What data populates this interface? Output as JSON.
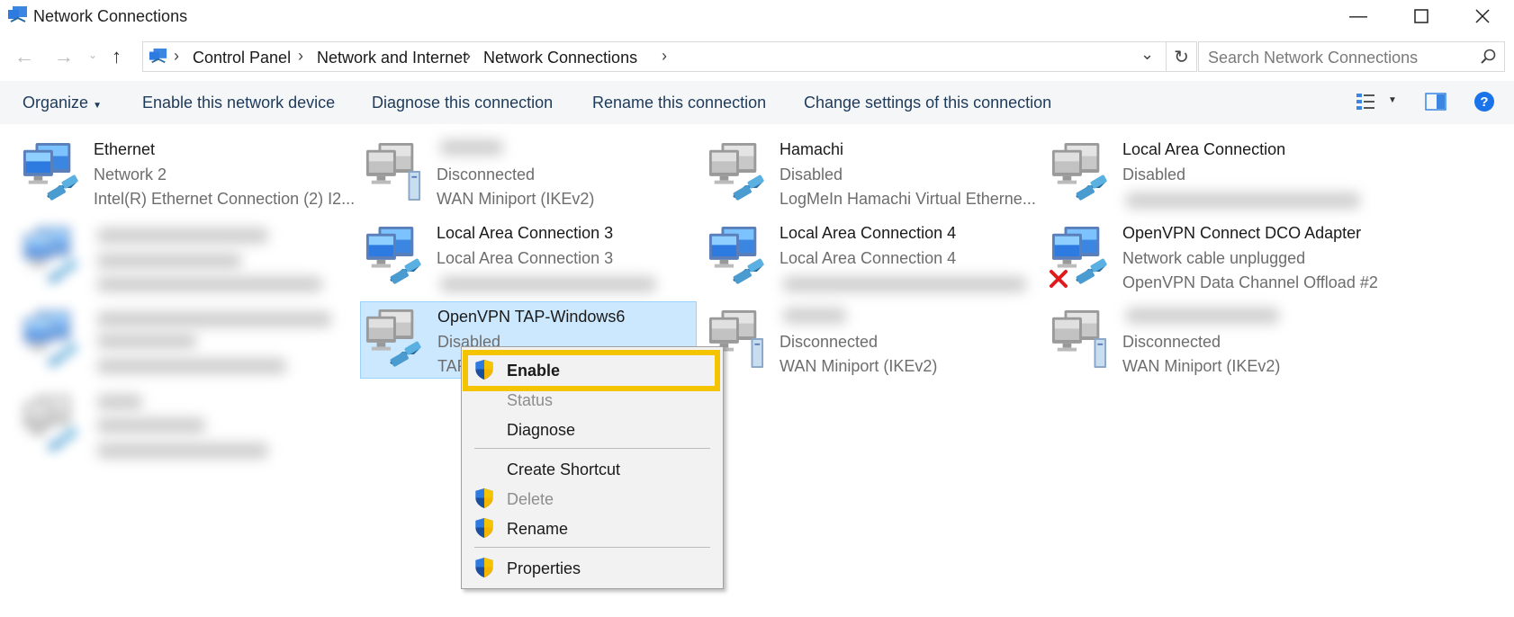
{
  "window": {
    "title": "Network Connections"
  },
  "address": {
    "crumbs": [
      "Control Panel",
      "Network and Internet",
      "Network Connections"
    ],
    "search_placeholder": "Search Network Connections"
  },
  "toolbar": {
    "organize": "Organize",
    "enable_device": "Enable this network device",
    "diagnose": "Diagnose this connection",
    "rename": "Rename this connection",
    "change_settings": "Change settings of this connection"
  },
  "connections": [
    {
      "name": "Ethernet",
      "status": "Network 2",
      "device": "Intel(R) Ethernet Connection (2) I2..."
    },
    {
      "name": "",
      "status": "Disconnected",
      "device": "WAN Miniport (IKEv2)"
    },
    {
      "name": "Hamachi",
      "status": "Disabled",
      "device": "LogMeIn Hamachi Virtual Etherne..."
    },
    {
      "name": "Local Area Connection",
      "status": "Disabled",
      "device": ""
    },
    {
      "name": "Local Area Connection 3",
      "status": "Local Area Connection 3",
      "device": ""
    },
    {
      "name": "Local Area Connection 4",
      "status": "Local Area Connection 4",
      "device": ""
    },
    {
      "name": "OpenVPN Connect DCO Adapter",
      "status": "Network cable unplugged",
      "device": "OpenVPN Data Channel Offload #2"
    },
    {
      "name": "OpenVPN TAP-Windows6",
      "status": "Disabled",
      "device": "TAP"
    },
    {
      "name": "",
      "status": "Disconnected",
      "device": "WAN Miniport (IKEv2)"
    },
    {
      "name": "",
      "status": "Disconnected",
      "device": "WAN Miniport (IKEv2)"
    }
  ],
  "context_menu": {
    "enable": "Enable",
    "status": "Status",
    "diagnose": "Diagnose",
    "create_shortcut": "Create Shortcut",
    "delete": "Delete",
    "rename": "Rename",
    "properties": "Properties"
  },
  "colors": {
    "selection": "#cce8ff",
    "highlight": "#f5c400",
    "help": "#1a73e8"
  },
  "icons": {
    "window": "network-connections-icon",
    "network": "network-adapter-icon",
    "wan": "wan-miniport-icon",
    "uac": "uac-shield-icon",
    "unplugged": "red-x-icon"
  }
}
